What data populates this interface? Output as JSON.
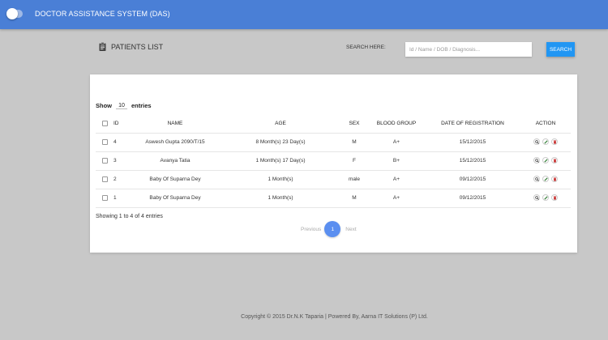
{
  "header": {
    "title": "DOCTOR ASSISTANCE SYSTEM (DAS)"
  },
  "page": {
    "title": "PATIENTS LIST",
    "icon": "clipboard-icon"
  },
  "search": {
    "label": "SEARCH HERE:",
    "placeholder": "Id / Name / DOB / Diagnosis...",
    "value": "",
    "button_label": "SEARCH"
  },
  "table": {
    "show_label": "Show",
    "entries_value": "10",
    "entries_label": "entries",
    "columns": {
      "id": "ID",
      "name": "NAME",
      "age": "AGE",
      "sex": "SEX",
      "blood_group": "BLOOD GROUP",
      "registration": "DATE OF REGISTRATION",
      "action": "ACTION"
    },
    "rows": [
      {
        "id": "4",
        "name": "Aswesh Gupta 2090/T/15",
        "age": "8 Month(s) 23 Day(s)",
        "sex": "M",
        "blood_group": "A+",
        "registration": "15/12/2015"
      },
      {
        "id": "3",
        "name": "Avanya Tatia",
        "age": "1 Month(s) 17 Day(s)",
        "sex": "F",
        "blood_group": "B+",
        "registration": "15/12/2015"
      },
      {
        "id": "2",
        "name": "Baby Of Suparna Dey",
        "age": "1 Month(s)",
        "sex": "male",
        "blood_group": "A+",
        "registration": "09/12/2015"
      },
      {
        "id": "1",
        "name": "Baby Of Suparna Dey",
        "age": "1 Month(s)",
        "sex": "M",
        "blood_group": "A+",
        "registration": "09/12/2015"
      }
    ],
    "action_icons": [
      "search-icon",
      "edit-icon",
      "delete-icon"
    ],
    "showing_text": "Showing 1 to 4 of 4 entries"
  },
  "pagination": {
    "previous": "Previous",
    "current": "1",
    "next": "Next"
  },
  "footer": {
    "text": "Copyright © 2015 Dr.N.K Taparia | Powered By, Aarna IT Solutions (P) Ltd."
  },
  "colors": {
    "header": "#4a7fd6",
    "search_button": "#2196f3",
    "page_active": "#5b8ff0",
    "background": "#c8c8c8"
  }
}
